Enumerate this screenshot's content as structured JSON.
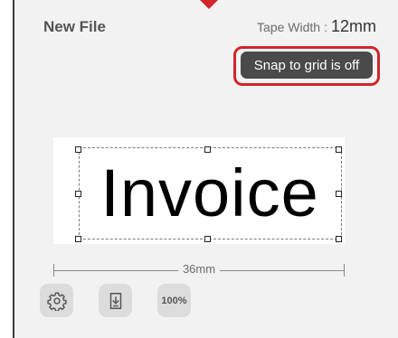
{
  "header": {
    "file_title": "New File",
    "tape_width_label": "Tape Width",
    "tape_width_separator": ":",
    "tape_width_value": "12mm"
  },
  "snap_button": {
    "label": "Snap to grid is off"
  },
  "canvas": {
    "text": "Invoice",
    "width_measure": "36mm"
  },
  "toolbar": {
    "settings_icon": "gear-icon",
    "import_icon": "download-icon",
    "zoom_label": "100%"
  },
  "colors": {
    "highlight": "#d1262a",
    "button_dark": "#4a4a4a",
    "panel_bg": "#f2f2f2"
  }
}
